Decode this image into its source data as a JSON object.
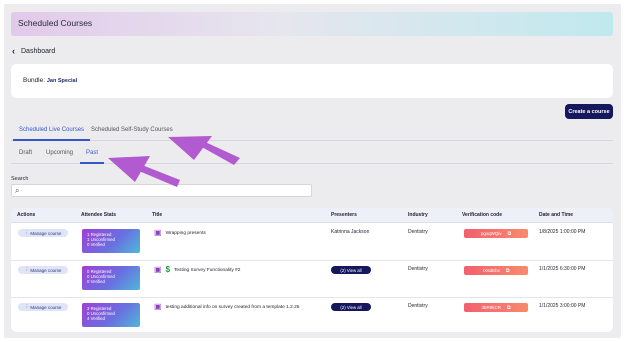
{
  "page_title": "Scheduled Courses",
  "breadcrumb": {
    "back_label": "Dashboard"
  },
  "bundle": {
    "label": "Bundle:",
    "value": "Jan Special"
  },
  "create_button": "Create a course",
  "course_tabs": [
    "Scheduled Live Courses",
    "Scheduled Self-Study Courses"
  ],
  "status_tabs": [
    "Draft",
    "Upcoming",
    "Past"
  ],
  "search": {
    "label": "Search",
    "placeholder": ""
  },
  "table": {
    "headers": [
      "Actions",
      "Attendee Stats",
      "Title",
      "Presenters",
      "Industry",
      "Verification code",
      "Date and Time"
    ],
    "rows": [
      {
        "action": "Manage course",
        "stats": [
          "1 Registered",
          "1 Unconfirmed",
          "0 Verified"
        ],
        "title": "Wrapping presents",
        "presenters": "Katrinna Jackson",
        "industry": "Dentistry",
        "verification": "pgxqWQiv",
        "datetime": "1/8/2025 1:00:00 PM"
      },
      {
        "action": "Manage course",
        "stats": [
          "0 Registered",
          "0 Unconfirmed",
          "0 Verified"
        ],
        "title": "Testing Survey Functionality #2",
        "presenters": "(2) View all",
        "industry": "Dentistry",
        "verification": "rX6dEbx",
        "datetime": "1/1/2025 6:30:00 PM"
      },
      {
        "action": "Manage course",
        "stats": [
          "3 Registered",
          "0 Unconfirmed",
          "4 Verified"
        ],
        "title": "testing additional info on survey created from a template 1.2.25",
        "presenters": "(2) View all",
        "industry": "Dentistry",
        "verification": "3bR9kCR",
        "datetime": "1/1/2025 3:00:00 PM"
      }
    ]
  },
  "colors": {
    "accent": "#3657c9",
    "primary_button": "#15185c",
    "annotation_arrow": "#b25ad0"
  }
}
